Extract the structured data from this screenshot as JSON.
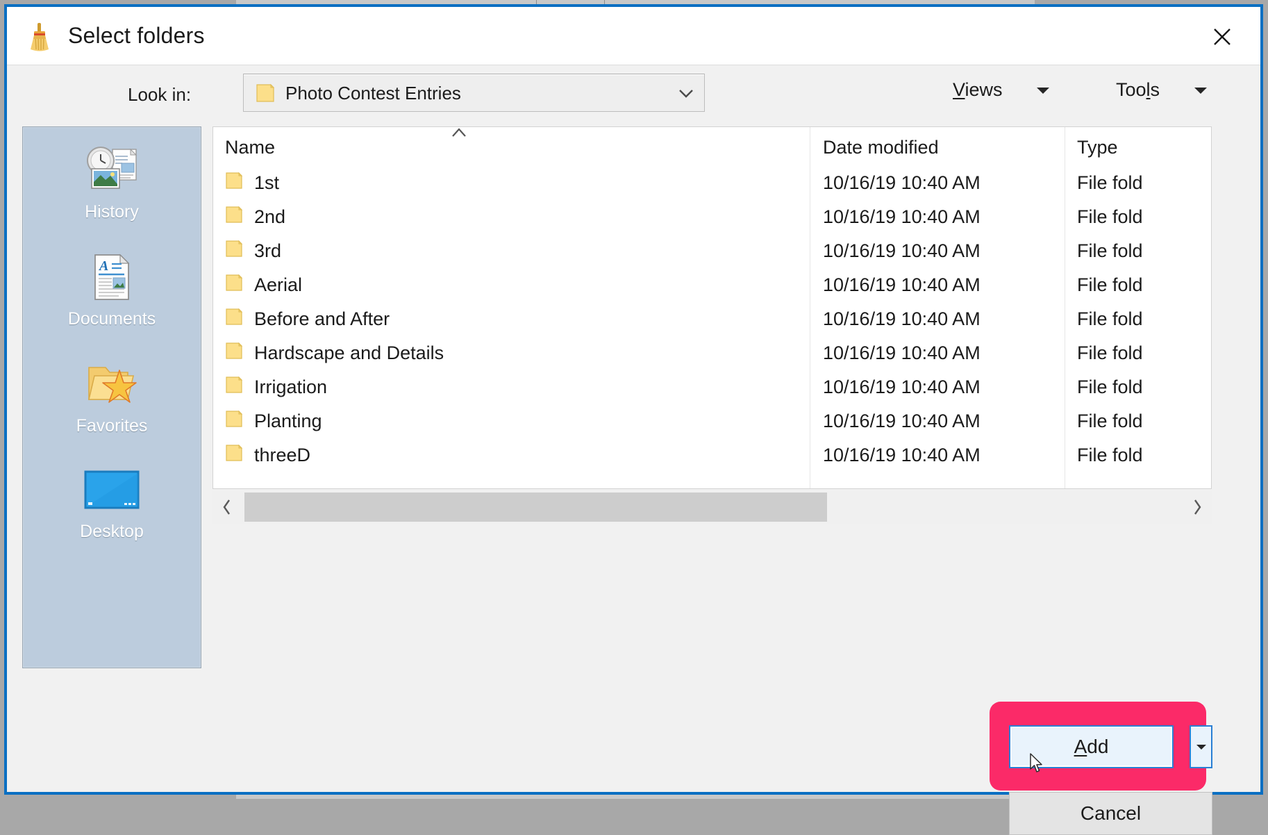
{
  "window": {
    "title": "Select folders",
    "app_icon": "broom-icon",
    "close_label": "✕",
    "border_color": "#0a6fc2"
  },
  "toolbar": {
    "lookin_label": "Look in:",
    "lookin_value": "Photo Contest Entries",
    "lookin_icon": "folder-icon",
    "views_label": "Views",
    "views_accel": "V",
    "tools_label": "Tools",
    "tools_accel": "l"
  },
  "places": {
    "items": [
      {
        "label": "History",
        "icon": "history-icon"
      },
      {
        "label": "Documents",
        "icon": "documents-icon"
      },
      {
        "label": "Favorites",
        "icon": "favorites-icon"
      },
      {
        "label": "Desktop",
        "icon": "desktop-icon"
      }
    ]
  },
  "file_list": {
    "columns": [
      "Name",
      "Date modified",
      "Type"
    ],
    "sort_column": "Name",
    "sort_direction": "ascending",
    "rows": [
      {
        "name": "1st",
        "date": "10/16/19 10:40 AM",
        "type": "File fold"
      },
      {
        "name": "2nd",
        "date": "10/16/19 10:40 AM",
        "type": "File fold"
      },
      {
        "name": "3rd",
        "date": "10/16/19 10:40 AM",
        "type": "File fold"
      },
      {
        "name": "Aerial",
        "date": "10/16/19 10:40 AM",
        "type": "File fold"
      },
      {
        "name": "Before and After",
        "date": "10/16/19 10:40 AM",
        "type": "File fold"
      },
      {
        "name": "Hardscape and Details",
        "date": "10/16/19 10:40 AM",
        "type": "File fold"
      },
      {
        "name": "Irrigation",
        "date": "10/16/19 10:40 AM",
        "type": "File fold"
      },
      {
        "name": "Planting",
        "date": "10/16/19 10:40 AM",
        "type": "File fold"
      },
      {
        "name": "threeD",
        "date": "10/16/19 10:40 AM",
        "type": "File fold"
      }
    ]
  },
  "scrollbar": {
    "left_glyph": "‹",
    "right_glyph": "›"
  },
  "actions": {
    "add_label": "Add",
    "add_accel": "A",
    "cancel_label": "Cancel",
    "highlight_color": "#fb2a68"
  }
}
